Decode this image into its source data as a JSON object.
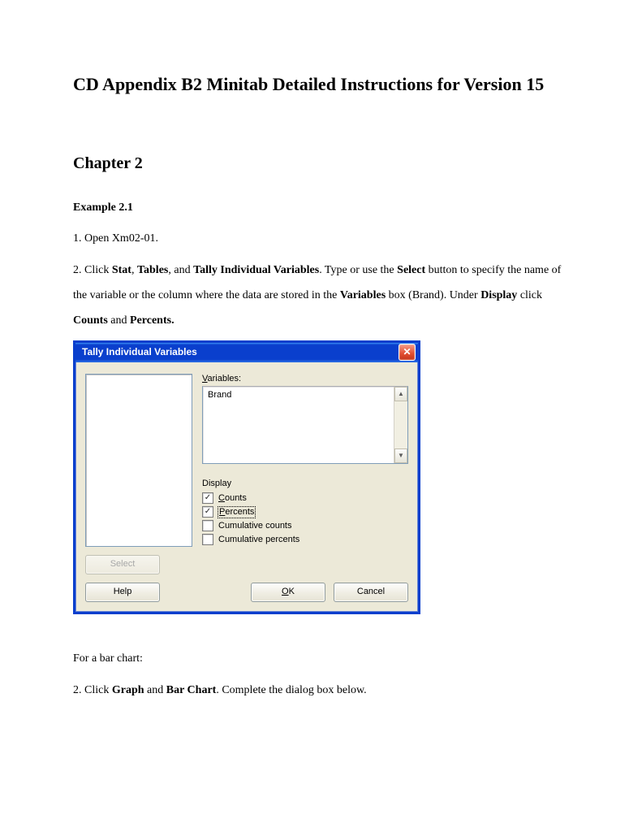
{
  "doc": {
    "title": "CD Appendix B2 Minitab Detailed Instructions for Version 15",
    "chapter": "Chapter 2",
    "example": "Example 2.1",
    "step1": "1. Open Xm02-01.",
    "step2_a": "2. Click ",
    "step2_stat": "Stat",
    "step2_b": ", ",
    "step2_tables": "Tables",
    "step2_c": ", and ",
    "step2_tiv": "Tally Individual Variables",
    "step2_d": ". Type or use the ",
    "step2_select": "Select",
    "step2_e": " button to specify the name of the variable or the column where the data are stored in the ",
    "step2_vars": "Variables",
    "step2_f": " box (Brand). Under ",
    "step2_display": "Display",
    "step2_g": " click ",
    "step2_counts": "Counts",
    "step2_h": " and ",
    "step2_percents": "Percents.",
    "bar_intro": "For a bar chart:",
    "bar_step_a": "2. Click ",
    "bar_graph": "Graph",
    "bar_step_b": " and ",
    "bar_chart": "Bar Chart",
    "bar_step_c": ". Complete the dialog box below."
  },
  "dialog": {
    "title": "Tally Individual Variables",
    "close_glyph": "✕",
    "variables_label": "Variables:",
    "variables_underline": "V",
    "variables_rest": "ariables:",
    "variables_value": "Brand",
    "scroll_up": "▲",
    "scroll_down": "▼",
    "display_label": "Display",
    "options": {
      "counts": {
        "u": "C",
        "rest": "ounts",
        "checked": true
      },
      "percents": {
        "u": "P",
        "rest": "ercents",
        "checked": true,
        "focused": true
      },
      "cum_counts": {
        "u": "",
        "rest": "Cumulative counts",
        "checked": false
      },
      "cum_percents": {
        "u": "",
        "rest": "Cumulative percents",
        "checked": false
      }
    },
    "buttons": {
      "select": "Select",
      "help": "Help",
      "ok_u": "O",
      "ok_rest": "K",
      "cancel": "Cancel"
    },
    "check_glyph": "✓"
  }
}
